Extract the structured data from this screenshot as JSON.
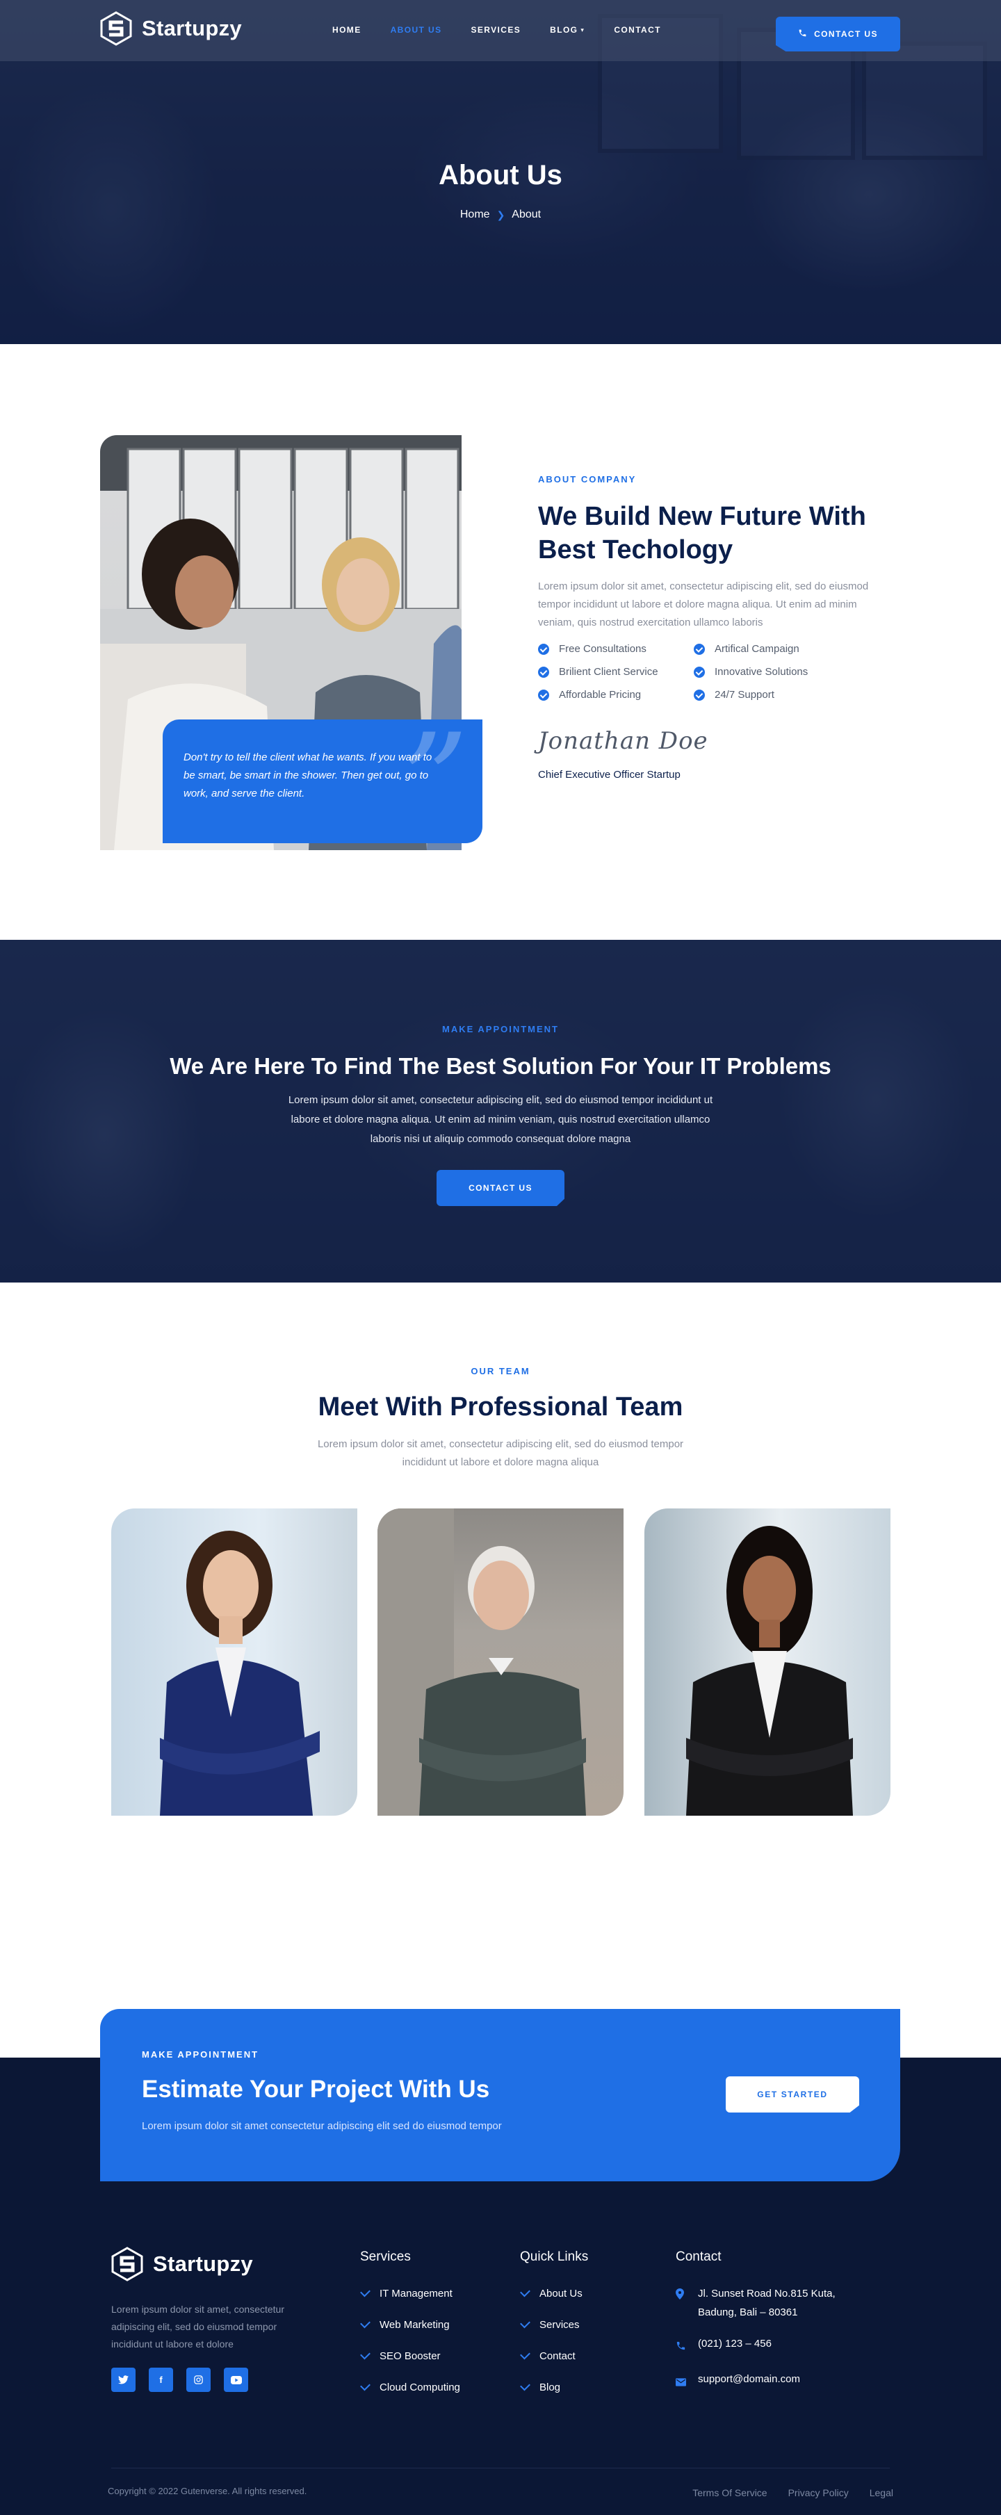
{
  "brand": {
    "name": "Startupzy"
  },
  "nav": {
    "items": [
      {
        "label": "HOME",
        "active": false
      },
      {
        "label": "ABOUT US",
        "active": true
      },
      {
        "label": "SERVICES",
        "active": false
      },
      {
        "label": "BLOG",
        "active": false,
        "has_dropdown": true
      },
      {
        "label": "CONTACT",
        "active": false
      }
    ],
    "cta": "CONTACT US"
  },
  "hero": {
    "title": "About Us",
    "breadcrumb": [
      "Home",
      "About"
    ]
  },
  "about": {
    "quote": "Don't try to tell the client what he wants. If you want to be smart, be smart in the shower. Then get out, go to work, and serve the client.",
    "kicker": "ABOUT COMPANY",
    "title": "We Build New Future With Best Techology",
    "text": "Lorem ipsum dolor sit amet, consectetur adipiscing elit, sed do eiusmod tempor incididunt ut labore et dolore magna aliqua. Ut enim ad minim veniam, quis nostrud exercitation ullamco laboris",
    "features": [
      "Free Consultations",
      "Artifical Campaign",
      "Brilient Client Service",
      "Innovative Solutions",
      "Affordable Pricing",
      "24/7 Support"
    ],
    "signature": "Jonathan Doe",
    "role": "Chief Executive Officer Startup"
  },
  "appointment": {
    "kicker": "MAKE APPOINTMENT",
    "title": "We Are Here To Find The Best Solution For Your IT Problems",
    "text": "Lorem ipsum dolor sit amet, consectetur adipiscing elit, sed do eiusmod tempor incididunt ut labore et dolore magna aliqua. Ut enim ad minim veniam, quis nostrud exercitation ullamco laboris nisi ut aliquip commodo consequat dolore magna",
    "button": "CONTACT US"
  },
  "team": {
    "kicker": "OUR TEAM",
    "title": "Meet With Professional Team",
    "text": "Lorem ipsum dolor sit amet, consectetur adipiscing elit, sed do eiusmod tempor incididunt ut labore et dolore magna aliqua"
  },
  "cta": {
    "kicker": "MAKE APPOINTMENT",
    "title": "Estimate Your Project With Us",
    "text": "Lorem ipsum dolor sit amet consectetur adipiscing elit sed do eiusmod tempor",
    "button": "GET STARTED"
  },
  "footer": {
    "about": "Lorem ipsum dolor sit amet, consectetur adipiscing elit, sed do eiusmod tempor incididunt ut labore et dolore",
    "socials": [
      "twitter-icon",
      "facebook-icon",
      "instagram-icon",
      "youtube-icon"
    ],
    "services": {
      "title": "Services",
      "items": [
        "IT Management",
        "Web Marketing",
        "SEO Booster",
        "Cloud Computing"
      ]
    },
    "links": {
      "title": "Quick Links",
      "items": [
        "About Us",
        "Services",
        "Contact",
        "Blog"
      ]
    },
    "contact": {
      "title": "Contact",
      "address": "Jl. Sunset Road No.815 Kuta, Badung, Bali – 80361",
      "phone": "(021) 123 – 456",
      "email": "support@domain.com"
    },
    "copyright": "Copyright © 2022 Gutenverse. All rights reserved.",
    "legal": [
      "Terms Of Service",
      "Privacy Policy",
      "Legal"
    ]
  },
  "colors": {
    "accent": "#1f6fe5",
    "navy": "#0b1f4b",
    "footer_bg": "#0b1735"
  }
}
